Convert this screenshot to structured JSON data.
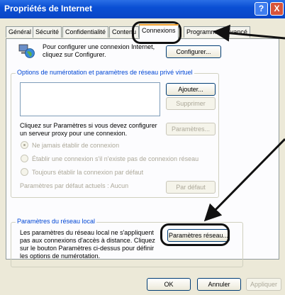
{
  "window": {
    "title": "Propriétés de Internet"
  },
  "titlebar_buttons": {
    "help": "?",
    "close": "X"
  },
  "tabs": [
    "Général",
    "Sécurité",
    "Confidentialité",
    "Contenu",
    "Connexions",
    "Programmes",
    "Avancé"
  ],
  "active_tab": "Connexions",
  "setup": {
    "text": "Pour configurer une connexion Internet, cliquez sur Configurer.",
    "button": "Configurer..."
  },
  "dialup": {
    "legend": "Options de numérotation et paramètres de réseau privé virtuel",
    "add_button": "Ajouter...",
    "remove_button": "Supprimer",
    "proxy_text": "Cliquez sur Paramètres si vous devez configurer un serveur proxy pour une connexion.",
    "settings_button": "Paramètres...",
    "radio_never": "Ne jamais établir de connexion",
    "radio_when_none": "Établir une connexion s'il n'existe pas de connexion réseau",
    "radio_always": "Toujours établir la connexion par défaut",
    "current_default": "Paramètres par défaut actuels :  Aucun",
    "default_button": "Par défaut"
  },
  "lan": {
    "legend": "Paramètres du réseau local",
    "text": "Les paramètres du réseau local ne s'appliquent pas aux connexions d'accès à distance. Cliquez sur le bouton Paramètres ci-dessus pour définir les options de numérotation.",
    "button": "Paramètres réseau..."
  },
  "footer": {
    "ok": "OK",
    "cancel": "Annuler",
    "apply": "Appliquer"
  },
  "colors": {
    "titlebar": "#0a4fd4",
    "legend": "#0046d5",
    "dialog_bg": "#ece9d8"
  },
  "icons": [
    "network-globe-icon",
    "help-icon",
    "close-icon",
    "arrow-icon"
  ]
}
